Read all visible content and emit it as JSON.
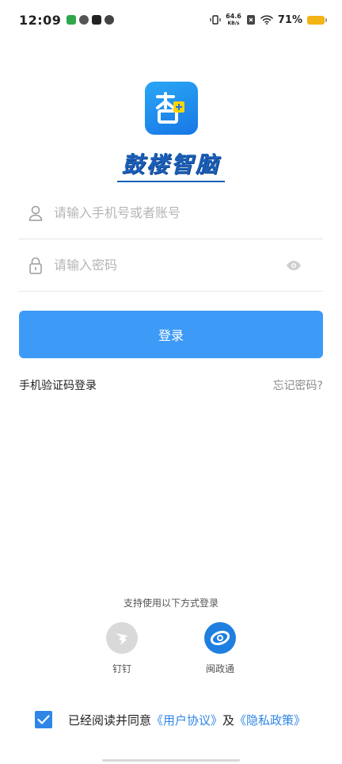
{
  "status_bar": {
    "time": "12:09",
    "net_speed_value": "64.6",
    "net_speed_unit": "KB/s",
    "battery": "71%"
  },
  "brand": {
    "name": "鼓楼智脑"
  },
  "form": {
    "account_placeholder": "请输入手机号或者账号",
    "password_placeholder": "请输入密码",
    "login_label": "登录",
    "sms_login": "手机验证码登录",
    "forgot_password": "忘记密码?"
  },
  "alt_login": {
    "title": "支持使用以下方式登录",
    "options": [
      {
        "label": "钉钉",
        "icon": "dingtalk-icon",
        "color": "#d9d9d9"
      },
      {
        "label": "闽政通",
        "icon": "minzhengtong-icon",
        "color": "#1f7fe0"
      }
    ]
  },
  "agreement": {
    "prefix": "已经阅读并同意",
    "user_agreement": "《用户协议》",
    "and": "及",
    "privacy_policy": "《隐私政策》",
    "checked": true
  },
  "colors": {
    "primary": "#3d9bf7",
    "link": "#2f86e6"
  }
}
